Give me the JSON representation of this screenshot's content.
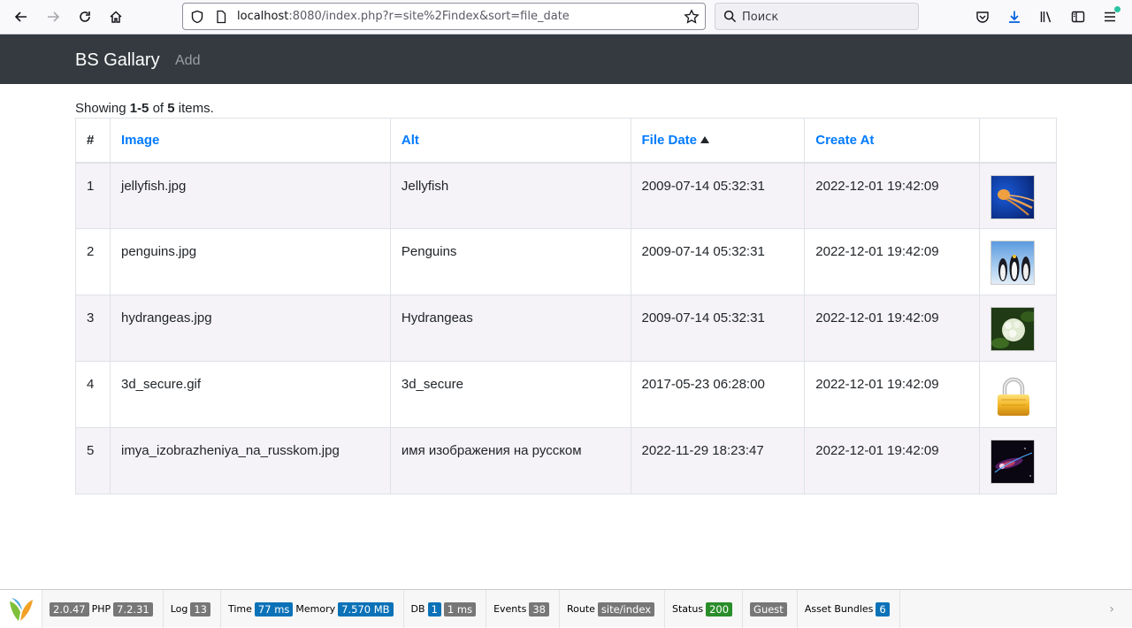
{
  "browser": {
    "url_host": "localhost",
    "url_rest": ":8080/index.php?r=site%2Findex&sort=file_date",
    "search_placeholder": "Поиск"
  },
  "navbar": {
    "brand": "BS Gallary",
    "add_label": "Add"
  },
  "summary": {
    "prefix": "Showing ",
    "range": "1-5",
    "of": " of ",
    "total": "5",
    "suffix": " items."
  },
  "table": {
    "headers": {
      "num": "#",
      "image": "Image",
      "alt": "Alt",
      "file_date": "File Date",
      "create_at": "Create At"
    },
    "sort_column": "file_date",
    "sort_direction": "asc",
    "rows": [
      {
        "num": "1",
        "image": "jellyfish.jpg",
        "alt": "Jellyfish",
        "file_date": "2009-07-14 05:32:31",
        "create_at": "2022-12-01 19:42:09",
        "thumb": "jellyfish-thumbnail"
      },
      {
        "num": "2",
        "image": "penguins.jpg",
        "alt": "Penguins",
        "file_date": "2009-07-14 05:32:31",
        "create_at": "2022-12-01 19:42:09",
        "thumb": "penguins-thumbnail"
      },
      {
        "num": "3",
        "image": "hydrangeas.jpg",
        "alt": "Hydrangeas",
        "file_date": "2009-07-14 05:32:31",
        "create_at": "2022-12-01 19:42:09",
        "thumb": "hydrangeas-thumbnail"
      },
      {
        "num": "4",
        "image": "3d_secure.gif",
        "alt": "3d_secure",
        "file_date": "2017-05-23 06:28:00",
        "create_at": "2022-12-01 19:42:09",
        "thumb": "padlock-thumbnail"
      },
      {
        "num": "5",
        "image": "imya_izobrazheniya_na_russkom.jpg",
        "alt": "имя изображения на русском",
        "file_date": "2022-11-29 18:23:47",
        "create_at": "2022-12-01 19:42:09",
        "thumb": "space-thumbnail"
      }
    ]
  },
  "debug": {
    "yii_version": "2.0.47",
    "php_label": "PHP",
    "php_version": "7.2.31",
    "log_label": "Log",
    "log_count": "13",
    "time_label": "Time",
    "time_value": "77 ms",
    "memory_label": "Memory",
    "memory_value": "7.570 MB",
    "db_label": "DB",
    "db_count": "1",
    "db_time": "1 ms",
    "events_label": "Events",
    "events_count": "38",
    "route_label": "Route",
    "route_value": "site/index",
    "status_label": "Status",
    "status_value": "200",
    "user": "Guest",
    "assets_label": "Asset Bundles",
    "assets_count": "6"
  },
  "colors": {
    "navbar_bg": "#343a40",
    "link": "#007bff",
    "badge_info": "#0b72b8",
    "badge_success": "#2a8d2a",
    "badge_default": "#777777"
  }
}
